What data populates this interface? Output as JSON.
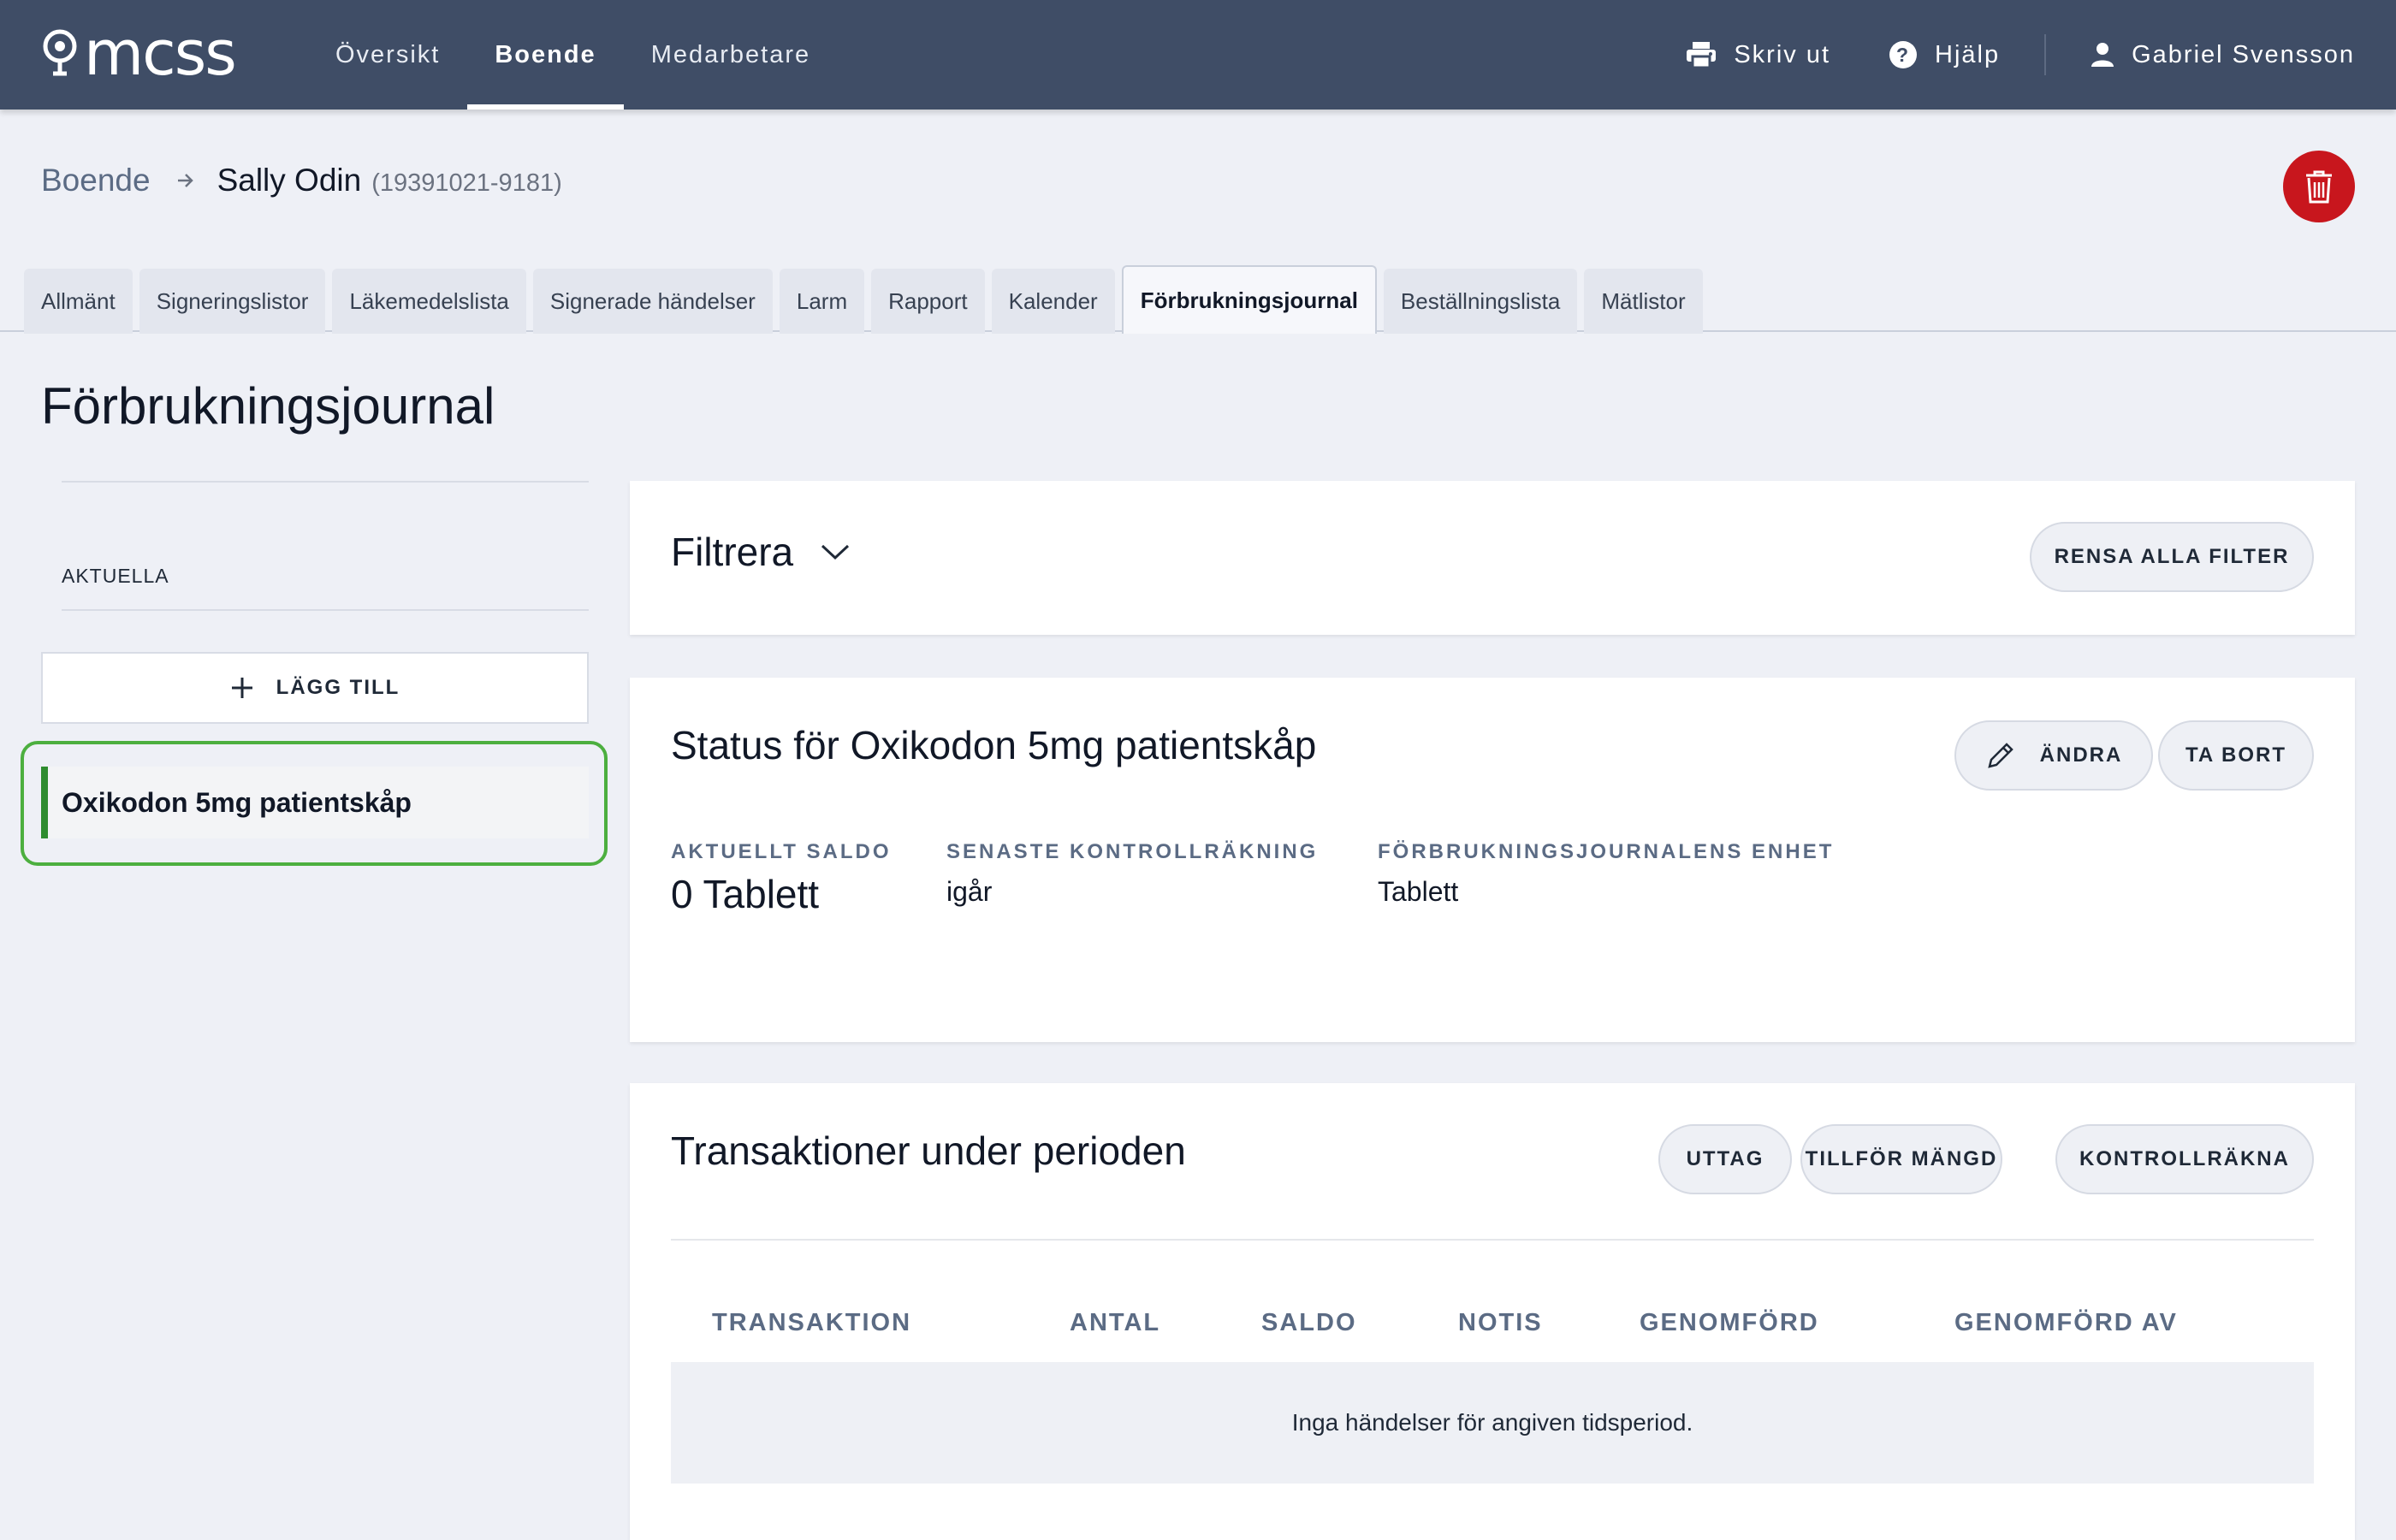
{
  "header": {
    "logo_text": "mcss",
    "nav": [
      {
        "label": "Översikt",
        "active": false
      },
      {
        "label": "Boende",
        "active": true
      },
      {
        "label": "Medarbetare",
        "active": false
      }
    ],
    "print_label": "Skriv ut",
    "help_label": "Hjälp",
    "user_name": "Gabriel Svensson"
  },
  "breadcrumb": {
    "parent": "Boende",
    "name": "Sally Odin",
    "id": "(19391021-9181)"
  },
  "tabs": [
    {
      "label": "Allmänt",
      "active": false
    },
    {
      "label": "Signeringslistor",
      "active": false
    },
    {
      "label": "Läkemedelslista",
      "active": false
    },
    {
      "label": "Signerade händelser",
      "active": false
    },
    {
      "label": "Larm",
      "active": false
    },
    {
      "label": "Rapport",
      "active": false
    },
    {
      "label": "Kalender",
      "active": false
    },
    {
      "label": "Förbrukningsjournal",
      "active": true
    },
    {
      "label": "Beställningslista",
      "active": false
    },
    {
      "label": "Mätlistor",
      "active": false
    }
  ],
  "page_title": "Förbrukningsjournal",
  "sidebar": {
    "section_label": "AKTUELLA",
    "add_label": "LÄGG TILL",
    "items": [
      {
        "label": "Oxikodon 5mg patientskåp",
        "selected": true
      }
    ]
  },
  "filter": {
    "title": "Filtrera",
    "clear_label": "RENSA ALLA FILTER"
  },
  "status": {
    "title": "Status för Oxikodon 5mg patientskåp",
    "edit_label": "ÄNDRA",
    "remove_label": "TA BORT",
    "current_balance_label": "AKTUELLT SALDO",
    "current_balance_value": "0 Tablett",
    "last_count_label": "SENASTE KONTROLLRÄKNING",
    "last_count_value": "igår",
    "unit_label": "FÖRBRUKNINGSJOURNALENS ENHET",
    "unit_value": "Tablett"
  },
  "transactions": {
    "title": "Transaktioner under perioden",
    "withdraw_label": "UTTAG",
    "add_amount_label": "TILLFÖR MÄNGD",
    "count_label": "KONTROLLRÄKNA",
    "columns": [
      "TRANSAKTION",
      "ANTAL",
      "SALDO",
      "NOTIS",
      "GENOMFÖRD",
      "GENOMFÖRD AV"
    ],
    "empty_text": "Inga händelser för angiven tidsperiod."
  },
  "colors": {
    "topbar": "#3f4d66",
    "delete": "#c8161d",
    "selected_outline": "#4caf3f",
    "selected_bar": "#2e8c2f"
  }
}
